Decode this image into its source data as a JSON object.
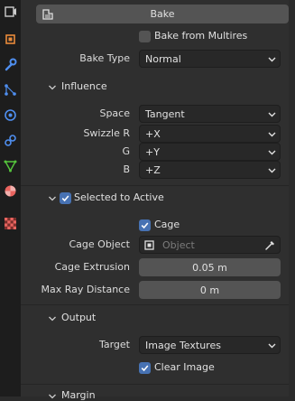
{
  "tabs": [
    {
      "icon": "render-icon",
      "color": "#cccccc"
    },
    {
      "icon": "object-icon",
      "color": "#e98b3a"
    },
    {
      "icon": "modifier-wrench-icon",
      "color": "#4f8ff0"
    },
    {
      "icon": "particles-icon",
      "color": "#4f8ff0"
    },
    {
      "icon": "physics-icon",
      "color": "#4f8ff0"
    },
    {
      "icon": "constraint-icon",
      "color": "#4f8ff0"
    },
    {
      "icon": "object-data-icon",
      "color": "#55c43c"
    },
    {
      "icon": "material-icon",
      "color": "#e9645f"
    },
    {
      "icon": "texture-icon",
      "color": "#e9645f"
    }
  ],
  "bake": {
    "button_label": "Bake",
    "from_multires_label": "Bake from Multires",
    "from_multires_checked": false,
    "type_label": "Bake Type",
    "type_value": "Normal"
  },
  "influence": {
    "title": "Influence",
    "space_label": "Space",
    "space_value": "Tangent",
    "swizzle_r_label": "Swizzle R",
    "swizzle_r_value": "+X",
    "g_label": "G",
    "g_value": "+Y",
    "b_label": "B",
    "b_value": "+Z"
  },
  "selected_to_active": {
    "title": "Selected to Active",
    "checked": true,
    "cage_label": "Cage",
    "cage_checked": true,
    "cage_object_label": "Cage Object",
    "cage_object_placeholder": "Object",
    "cage_extrusion_label": "Cage Extrusion",
    "cage_extrusion_value": "0.05 m",
    "max_ray_label": "Max Ray Distance",
    "max_ray_value": "0 m"
  },
  "output": {
    "title": "Output",
    "target_label": "Target",
    "target_value": "Image Textures",
    "clear_image_label": "Clear Image",
    "clear_image_checked": true
  },
  "margin": {
    "title": "Margin"
  },
  "colors": {
    "accent": "#4772b3",
    "field_bg": "#282828",
    "number_bg": "#545454"
  }
}
